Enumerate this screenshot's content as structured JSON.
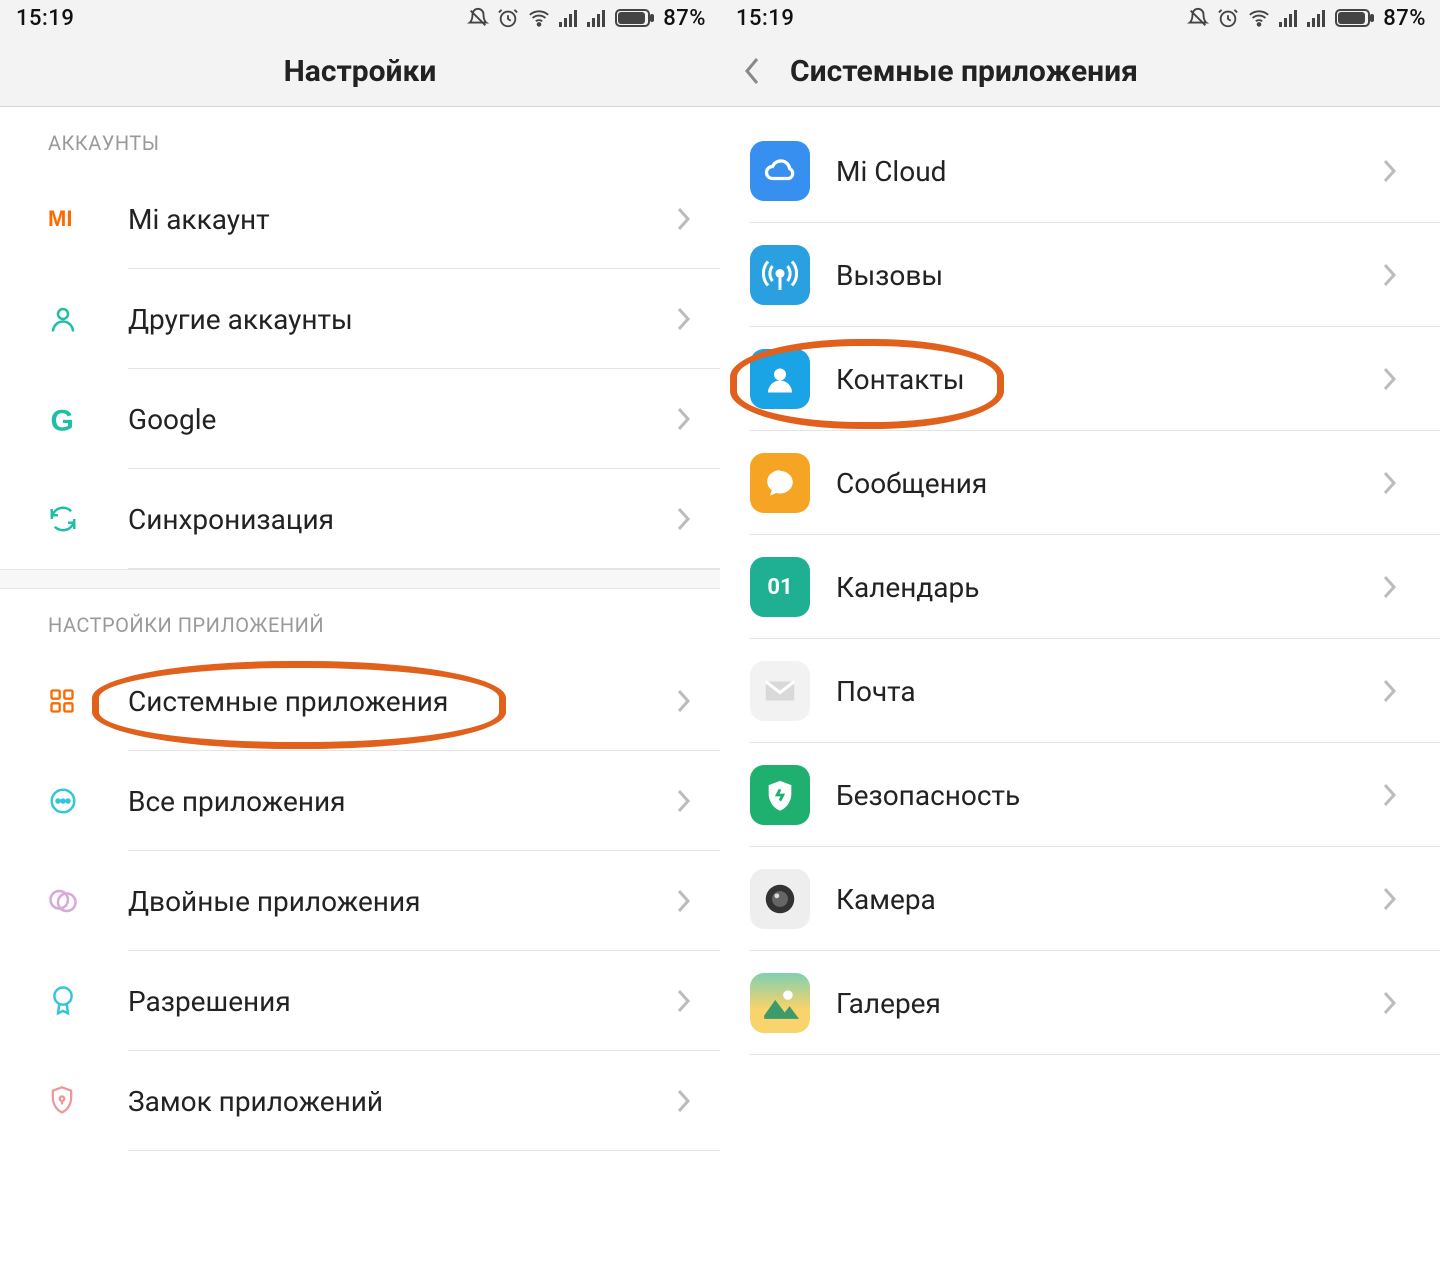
{
  "status": {
    "time": "15:19",
    "battery_pct": "87%"
  },
  "left": {
    "title": "Настройки",
    "section1": "АККАУНТЫ",
    "section2": "НАСТРОЙКИ ПРИЛОЖЕНИЙ",
    "rows": {
      "mi_account": "Mi аккаунт",
      "other_accounts": "Другие аккаунты",
      "google": "Google",
      "sync": "Синхронизация",
      "system_apps": "Системные приложения",
      "all_apps": "Все приложения",
      "dual_apps": "Двойные приложения",
      "permissions": "Разрешения",
      "app_lock": "Замок приложений"
    }
  },
  "right": {
    "title": "Системные приложения",
    "rows": {
      "mi_cloud": "Mi Cloud",
      "calls": "Вызовы",
      "contacts": "Контакты",
      "messages": "Сообщения",
      "calendar": "Календарь",
      "calendar_badge": "01",
      "mail": "Почта",
      "security": "Безопасность",
      "camera": "Камера",
      "gallery": "Галерея"
    }
  }
}
